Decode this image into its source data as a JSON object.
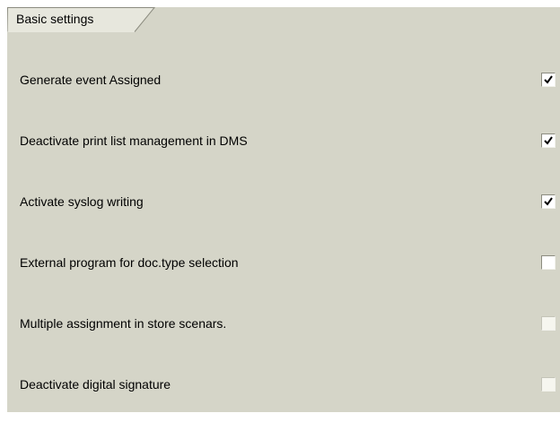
{
  "section": {
    "tab_label": "Basic settings"
  },
  "settings": [
    {
      "label": "Generate event Assigned",
      "checked": true,
      "enabled": true
    },
    {
      "label": "Deactivate print list management in DMS",
      "checked": true,
      "enabled": true
    },
    {
      "label": "Activate syslog writing",
      "checked": true,
      "enabled": true
    },
    {
      "label": "External program for doc.type selection",
      "checked": false,
      "enabled": true
    },
    {
      "label": "Multiple assignment in store scenars.",
      "checked": false,
      "enabled": false
    },
    {
      "label": "Deactivate digital signature",
      "checked": false,
      "enabled": false
    }
  ],
  "colors": {
    "panel_background": "#d5d5c8",
    "page_background": "#ffffff",
    "text": "#000000"
  },
  "icons": {
    "checked": "check-icon"
  }
}
